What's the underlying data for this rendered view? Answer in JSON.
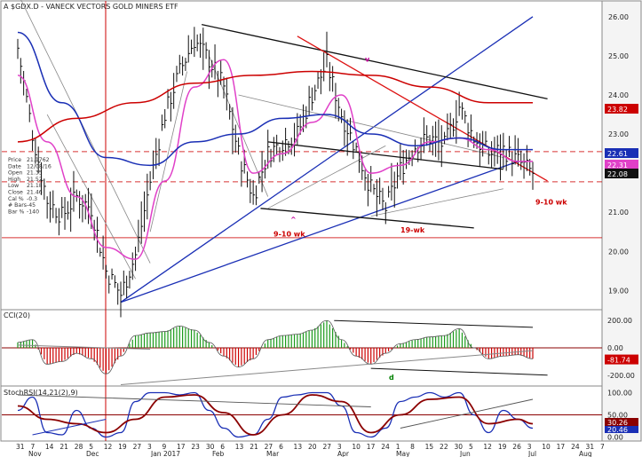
{
  "chart_data": [
    {
      "type": "line",
      "title": "$GDX.D - VANECK VECTORS GOLD MINERS ETF",
      "title_prefix": "A",
      "subtitle": "",
      "price_axis_ticks": [
        26.0,
        25.0,
        24.0,
        23.0,
        22.0,
        21.0,
        20.0,
        19.0
      ],
      "ylim": [
        18.6,
        26.2
      ],
      "last_values": [
        {
          "value": "23.82",
          "color": "#cc0000"
        },
        {
          "value": "22.61",
          "color": "#1a2fb5"
        },
        {
          "value": "22.31",
          "color": "#e040c8"
        },
        {
          "value": "22.08",
          "color": "#111111"
        }
      ],
      "info_box": {
        "labels": [
          "Price",
          "Date",
          "Open",
          "High",
          "Low",
          "Close",
          "Cal %",
          "# Bars",
          "Bar %"
        ],
        "values": [
          "21.1762",
          "12/08/16",
          "21.35",
          "21.52",
          "21.18",
          "21.46",
          "-0.3",
          "-45",
          "-140"
        ]
      },
      "annotations": [
        {
          "text": "v",
          "x": "Apr 13",
          "y": 24.85,
          "color": "#c4009c"
        },
        {
          "text": "^",
          "x": "Mar 13",
          "y": 20.75,
          "color": "#c4009c"
        },
        {
          "text": "9-10 wk",
          "x": "Mar 6",
          "y": 20.38,
          "color": "#cc0000"
        },
        {
          "text": "19-wk",
          "x": "May 1",
          "y": 20.48,
          "color": "#cc0000"
        },
        {
          "text": "9-10 wk",
          "x": "Jul 3",
          "y": 21.2,
          "color": "#cc0000"
        }
      ],
      "series": [
        {
          "name": "price",
          "color": "#111111",
          "x_week_index": [
            0,
            1,
            2,
            3,
            4,
            5,
            6,
            7,
            8,
            9,
            10,
            11,
            12,
            13,
            14,
            15,
            16,
            17,
            18,
            19,
            20,
            21,
            22,
            23,
            24,
            25,
            26,
            27,
            28,
            29,
            30,
            31,
            32,
            33,
            34,
            35
          ],
          "y": [
            25.2,
            23.0,
            21.3,
            20.9,
            21.4,
            21.1,
            19.5,
            18.9,
            19.9,
            21.8,
            23.5,
            24.6,
            25.4,
            24.9,
            24.2,
            22.5,
            21.4,
            22.5,
            22.8,
            23.0,
            24.0,
            24.8,
            23.5,
            22.6,
            21.6,
            21.1,
            22.1,
            22.7,
            22.9,
            22.7,
            23.7,
            22.9,
            22.5,
            22.6,
            22.3,
            22.0
          ]
        },
        {
          "name": "ma_short",
          "color": "#e040c8",
          "x_week_index": [
            0,
            2,
            4,
            6,
            8,
            10,
            12,
            14,
            16,
            18,
            20,
            22,
            24,
            26,
            28,
            30,
            32,
            34,
            35
          ],
          "y": [
            24.5,
            22.8,
            21.4,
            20.1,
            19.8,
            21.8,
            24.2,
            24.9,
            22.0,
            22.5,
            23.3,
            24.0,
            22.0,
            22.2,
            22.8,
            22.9,
            22.6,
            22.3,
            22.3
          ]
        },
        {
          "name": "ma_mid",
          "color": "#1a2fb5",
          "x_week_index": [
            0,
            3,
            6,
            9,
            12,
            15,
            18,
            21,
            24,
            27,
            30,
            33,
            35
          ],
          "y": [
            25.6,
            23.8,
            22.4,
            22.2,
            22.8,
            23.0,
            23.4,
            23.5,
            23.0,
            22.7,
            22.9,
            22.6,
            22.6
          ]
        },
        {
          "name": "ma_long",
          "color": "#cc0000",
          "x_week_index": [
            0,
            4,
            8,
            12,
            16,
            20,
            24,
            28,
            32,
            35
          ],
          "y": [
            22.8,
            23.4,
            23.8,
            24.3,
            24.5,
            24.6,
            24.5,
            24.2,
            23.8,
            23.8
          ]
        }
      ],
      "hlines": [
        {
          "y": 20.35,
          "color": "#cc0000",
          "style": "solid"
        },
        {
          "y": 22.55,
          "color": "#cc0000",
          "style": "dash"
        },
        {
          "y": 21.78,
          "color": "#cc0000",
          "style": "dash"
        }
      ]
    },
    {
      "type": "area",
      "title": "CCI(20)",
      "ylim": [
        -260,
        260
      ],
      "axis_ticks": [
        200.0,
        0.0,
        -100.0,
        -200.0
      ],
      "axis_tick_labels": [
        "200.00",
        "0.00",
        "-100.00",
        "-200.00"
      ],
      "last_value": "-81.74",
      "annotations": [
        {
          "text": "d",
          "x": "May 1",
          "color": "#008000"
        }
      ],
      "x_week_index": [
        0,
        1,
        2,
        3,
        4,
        5,
        6,
        7,
        8,
        9,
        10,
        11,
        12,
        13,
        14,
        15,
        16,
        17,
        18,
        19,
        20,
        21,
        22,
        23,
        24,
        25,
        26,
        27,
        28,
        29,
        30,
        31,
        32,
        33,
        34,
        35
      ],
      "values": [
        40,
        60,
        -120,
        -100,
        -40,
        -80,
        -190,
        -60,
        90,
        110,
        120,
        160,
        130,
        40,
        -60,
        -140,
        -80,
        60,
        90,
        100,
        130,
        200,
        60,
        -60,
        -120,
        -40,
        30,
        60,
        80,
        90,
        140,
        0,
        -80,
        -60,
        -50,
        -80
      ]
    },
    {
      "type": "line",
      "title": "StochRSI(14,21(2),9)",
      "ylim": [
        -5,
        105
      ],
      "axis_ticks": [
        100.0,
        50.0,
        0.0
      ],
      "axis_tick_labels": [
        "100.00",
        "50.00",
        "0.00"
      ],
      "last_values": [
        {
          "value": "20.46",
          "color": "#1a2fb5"
        },
        {
          "value": "30.26",
          "color": "#8b0000"
        }
      ],
      "series": [
        {
          "name": "fast",
          "color": "#1a2fb5",
          "x_week_index": [
            0,
            1,
            2,
            3,
            4,
            5,
            6,
            7,
            8,
            9,
            10,
            11,
            12,
            13,
            14,
            15,
            16,
            17,
            18,
            19,
            20,
            21,
            22,
            23,
            24,
            25,
            26,
            27,
            28,
            29,
            30,
            31,
            32,
            33,
            34,
            35
          ],
          "y": [
            60,
            90,
            10,
            5,
            60,
            20,
            0,
            10,
            80,
            100,
            100,
            95,
            100,
            60,
            20,
            0,
            5,
            40,
            90,
            95,
            100,
            100,
            70,
            10,
            0,
            20,
            80,
            90,
            100,
            90,
            100,
            50,
            10,
            60,
            40,
            20
          ]
        },
        {
          "name": "slow",
          "color": "#8b0000",
          "x_week_index": [
            0,
            2,
            4,
            6,
            8,
            10,
            12,
            14,
            16,
            18,
            20,
            22,
            24,
            26,
            28,
            30,
            32,
            34,
            35
          ],
          "y": [
            70,
            40,
            30,
            10,
            40,
            90,
            95,
            55,
            5,
            50,
            95,
            80,
            10,
            50,
            85,
            90,
            30,
            40,
            30
          ]
        }
      ]
    }
  ],
  "x_axis": {
    "ticks": [
      "31",
      "7",
      "14",
      "21",
      "28",
      "5",
      "12",
      "19",
      "27",
      "3",
      "9",
      "17",
      "23",
      "30",
      "6",
      "13",
      "21",
      "27",
      "6",
      "13",
      "20",
      "27",
      "3",
      "10",
      "17",
      "24",
      "1",
      "8",
      "15",
      "22",
      "30",
      "5",
      "12",
      "19",
      "26",
      "3",
      "10",
      "17",
      "24",
      "31",
      "7"
    ],
    "month_labels": [
      "Nov",
      "Dec",
      "Jan 2017",
      "Feb",
      "Mar",
      "Apr",
      "May",
      "Jun",
      "Jul",
      "Aug"
    ]
  },
  "colors": {
    "price": "#111111",
    "ma_short": "#e040c8",
    "ma_mid": "#1a2fb5",
    "ma_long": "#cc0000",
    "trend_black": "#111111",
    "trend_blue": "#1a2fb5",
    "trend_red": "#dd1111",
    "trend_gray": "#888888",
    "cci_pos": "#1a9a1a",
    "cci_neg": "#cc0000"
  }
}
